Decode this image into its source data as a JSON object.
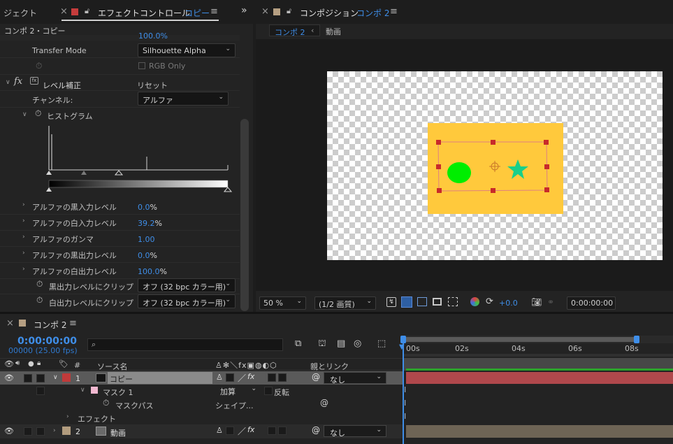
{
  "effect_controls": {
    "tab_left": "ジェクト",
    "tab_title": "エフェクトコントロール",
    "tab_layer": "コピー",
    "comp_layer": "コンポ 2・コピー",
    "partial_value": "100.0%",
    "transfer_mode_label": "Transfer Mode",
    "transfer_mode_value": "Silhouette Alpha",
    "rgb_only_label": "RGB Only",
    "fx_label": "fx",
    "effect_name": "レベル補正",
    "reset_label": "リセット",
    "channel_label": "チャンネル:",
    "channel_value": "アルファ",
    "histogram_label": "ヒストグラム",
    "params": [
      {
        "label": "アルファの黒入力レベル",
        "value": "0.0",
        "unit": "%"
      },
      {
        "label": "アルファの白入力レベル",
        "value": "39.2",
        "unit": "%"
      },
      {
        "label": "アルファのガンマ",
        "value": "1.00",
        "unit": ""
      },
      {
        "label": "アルファの黒出力レベル",
        "value": "0.0",
        "unit": "%"
      },
      {
        "label": "アルファの白出力レベル",
        "value": "100.0",
        "unit": "%"
      }
    ],
    "clip_black_label": "黒出力レベルにクリップ",
    "clip_black_value": "オフ (32 bpc カラー用)",
    "clip_white_label": "白出力レベルにクリップ",
    "clip_white_value": "オフ (32 bpc カラー用)"
  },
  "composition": {
    "tab_title": "コンポジション",
    "tab_comp": "コンポ 2",
    "crumb_current": "コンポ 2",
    "crumb_next": "動画",
    "zoom": "50 %",
    "resolution": "(1/2 画質)",
    "exposure": "+0.0",
    "timecode": "0:00:00:00",
    "colors": {
      "layer_bg": "#ffc93c",
      "ellipse": "#00ee00",
      "star": "#19cf8a",
      "handle": "#c82a2a"
    }
  },
  "timeline": {
    "comp_tab": "コンポ 2",
    "timecode": "0:00:00:00",
    "frames": "00000 (25.00 fps)",
    "col_number": "#",
    "col_source": "ソース名",
    "col_parent": "親とリンク",
    "ruler": [
      "00s",
      "02s",
      "04s",
      "06s",
      "08s"
    ],
    "layer1": {
      "number": "1",
      "name": "コピー",
      "parent": "なし"
    },
    "mask_name": "マスク 1",
    "mask_mode": "加算",
    "mask_invert": "反転",
    "mask_path_label": "マスクパス",
    "mask_path_value": "シェイプ...",
    "effects_label": "エフェクト",
    "layer2": {
      "number": "2",
      "name": "動画",
      "parent": "なし"
    },
    "colors": {
      "layer1_bar": "#b0484c",
      "layer2_bar": "#6e6455",
      "layer1_label": "#c03a3a",
      "layer2_label": "#b29c7e"
    }
  }
}
